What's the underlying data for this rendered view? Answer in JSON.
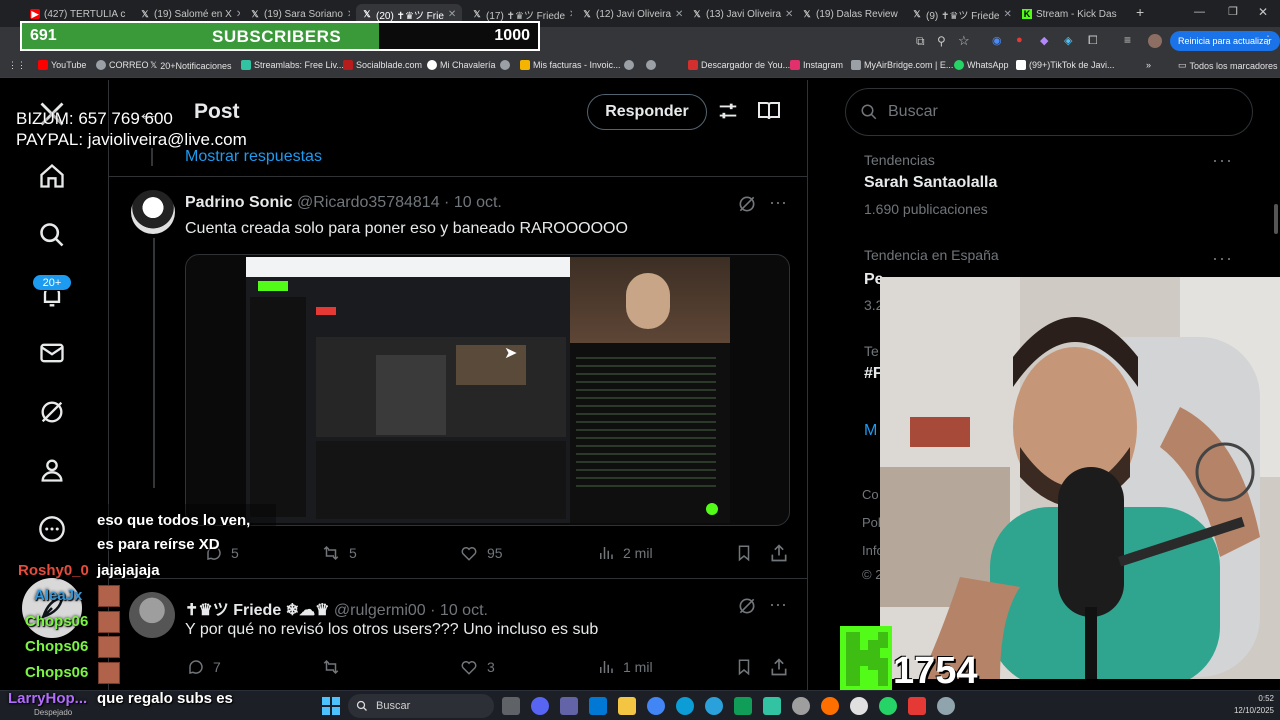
{
  "browser": {
    "tabs": [
      {
        "title": "(427) TERTULIA c",
        "icon": "youtube-icon",
        "active": false
      },
      {
        "title": "(19) Salomé en X",
        "icon": "x-icon",
        "active": false
      },
      {
        "title": "(19) Sara Soriano",
        "icon": "x-icon",
        "active": false
      },
      {
        "title": "(20) ✝♛ツ Frie",
        "icon": "x-icon",
        "active": true
      },
      {
        "title": "(17) ✝♛ツ Friede",
        "icon": "x-icon",
        "active": false
      },
      {
        "title": "(12) Javi Oliveira",
        "icon": "x-icon",
        "active": false
      },
      {
        "title": "(13) Javi Oliveira",
        "icon": "x-icon",
        "active": false
      },
      {
        "title": "(19) Dalas Review",
        "icon": "x-icon",
        "active": false
      },
      {
        "title": "(9) ✝♛ツ Friede",
        "icon": "x-icon",
        "active": false
      },
      {
        "title": "Stream - Kick Das",
        "icon": "kick-icon",
        "active": false
      }
    ],
    "update_button": "Reinicia para actualizar",
    "bookmarks": [
      {
        "label": "YouTube",
        "color": "#ff0000"
      },
      {
        "label": "CORREO",
        "color": "#9aa0a6"
      },
      {
        "label": "20+Notificaciones",
        "color": "#ffffff"
      },
      {
        "label": "Streamlabs: Free Liv...",
        "color": "#31c3a2"
      },
      {
        "label": "Socialblade.com",
        "color": "#b71c1c"
      },
      {
        "label": "Mi Chavalería",
        "color": "#ffffff"
      },
      {
        "label": "",
        "color": "#9aa0a6"
      },
      {
        "label": "Mis facturas - Invoic...",
        "color": "#f4b400"
      },
      {
        "label": "",
        "color": "#9aa0a6"
      },
      {
        "label": "",
        "color": "#9aa0a6"
      },
      {
        "label": "Descargador de You...",
        "color": "#d32f2f"
      },
      {
        "label": "Instagram",
        "color": "#e1306c"
      },
      {
        "label": "MyAirBridge.com | E...",
        "color": "#9aa0a6"
      },
      {
        "label": "WhatsApp",
        "color": "#25d366"
      },
      {
        "label": "(99+)TikTok de Javi...",
        "color": "#ffffff"
      }
    ],
    "bookmarks_folder": "Todos los marcadores"
  },
  "overlay": {
    "sub_goal": {
      "current": "691",
      "label": "SUBSCRIBERS",
      "target": "1000",
      "progress": 0.691,
      "fill_color": "#3a9a3a"
    },
    "donation_lines": [
      "BIZUM: 657 769 600",
      "PAYPAL: javioliveira@live.com"
    ],
    "kick_viewers": "1754",
    "chat": [
      {
        "user": "",
        "text": "eso que todos lo ven,",
        "user_color": "#ffffff"
      },
      {
        "user": "",
        "text": "es para reírse XD",
        "user_color": "#ffffff"
      },
      {
        "user": "Roshy0_0",
        "text": "jajajajaja",
        "user_color": "#e74c3c"
      },
      {
        "user": "AleaJx",
        "text": "",
        "user_color": "#3498db"
      },
      {
        "user": "Chops06",
        "text": "",
        "user_color": "#7bf542"
      },
      {
        "user": "Chops06",
        "text": "",
        "user_color": "#7bf542"
      },
      {
        "user": "Chops06",
        "text": "",
        "user_color": "#7bf542"
      },
      {
        "user": "LarryHop...",
        "text": "que regalo subs es",
        "user_color": "#b36bff"
      }
    ]
  },
  "header": {
    "title": "Post",
    "reply_button": "Responder"
  },
  "show_replies": "Mostrar respuestas",
  "nav": {
    "notifications_badge": "20+"
  },
  "tweets": [
    {
      "name": "Padrino Sonic",
      "handle": "@Ricardo35784814",
      "date": "· 10 oct.",
      "text": "Cuenta creada solo para poner eso y baneado RAROOOOOO",
      "replies": "5",
      "retweets": "5",
      "likes": "95",
      "views": "2 mil"
    },
    {
      "name": "✝♛ツ Friede ❄☁♛",
      "handle": "@rulgermi00",
      "date": "· 10 oct.",
      "text": "Y por qué no revisó los otros users??? Uno incluso es sub",
      "replies": "7",
      "retweets": "",
      "likes": "3",
      "views": "1 mil"
    }
  ],
  "sidebar": {
    "search_placeholder": "Buscar",
    "trends": [
      {
        "category": "Tendencias",
        "name": "Sarah Santaolalla",
        "count": "1.690 publicaciones"
      },
      {
        "category": "Tendencia en España",
        "name": "Pe",
        "count": "3.2"
      },
      {
        "category": "Te",
        "name": "#F",
        "count": ""
      }
    ],
    "show_more": "M",
    "footer_fragments": [
      "Co",
      "Pol",
      "Info",
      "© 2"
    ]
  },
  "taskbar": {
    "weather": "Despejado",
    "search": "Buscar",
    "time": "0:52",
    "date": "12/10/2025"
  }
}
